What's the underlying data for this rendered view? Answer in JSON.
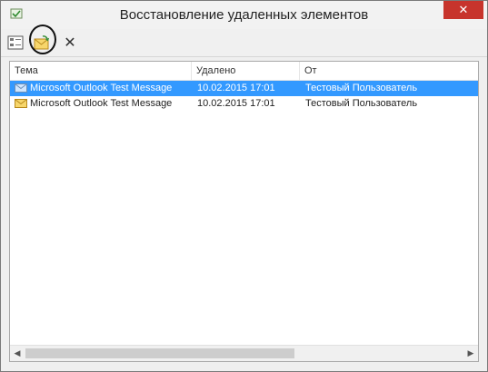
{
  "window": {
    "title": "Восстановление удаленных элементов",
    "close_glyph": "✕"
  },
  "toolbar": {
    "items": [
      {
        "name": "view-details-icon"
      },
      {
        "name": "recover-selected-items-icon",
        "highlighted": true
      },
      {
        "name": "purge-delete-icon",
        "glyph": "✕"
      }
    ]
  },
  "list": {
    "columns": [
      "Тема",
      "Удалено",
      "От"
    ],
    "rows": [
      {
        "subject": "Microsoft Outlook Test Message",
        "deleted": "10.02.2015 17:01",
        "from": "Тестовый Пользователь",
        "selected": true
      },
      {
        "subject": "Microsoft Outlook Test Message",
        "deleted": "10.02.2015 17:01",
        "from": "Тестовый Пользователь",
        "selected": false
      }
    ]
  },
  "scrollbar": {
    "left_arrow": "◀",
    "right_arrow": "▶"
  },
  "colors": {
    "selection": "#3399ff",
    "close": "#c7342c",
    "annotation": "#111111"
  }
}
